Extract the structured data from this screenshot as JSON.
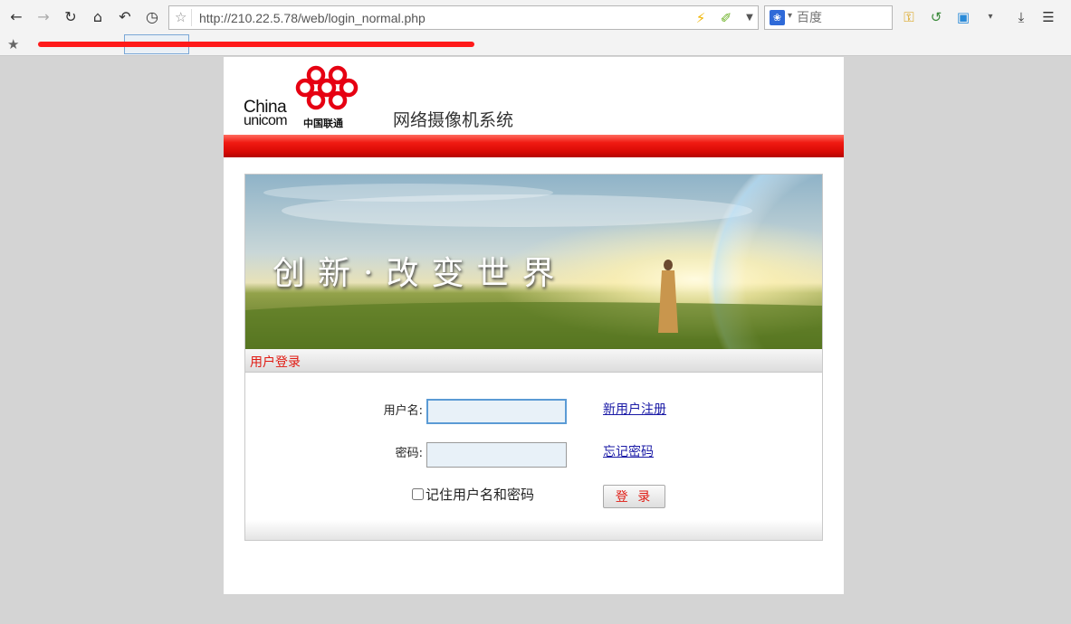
{
  "browser": {
    "url": "http://210.22.5.78/web/login_normal.php",
    "search_placeholder": "百度",
    "nav_icons": [
      "back-icon",
      "forward-icon",
      "reload-icon",
      "home-icon",
      "undo-icon",
      "history-icon"
    ],
    "toolbar_icons": [
      "lightning-icon",
      "pin-icon",
      "key-icon",
      "search-refresh-icon",
      "game-icon",
      "download-icon",
      "menu-icon"
    ]
  },
  "header": {
    "logo_en_line1": "China",
    "logo_en_line2": "unicom",
    "logo_cn": "中国联通",
    "system_title": "网络摄像机系统",
    "brand_red": "#e60012"
  },
  "banner": {
    "slogan": "创新·改变世界"
  },
  "login": {
    "section_title": "用户登录",
    "username_label": "用户名:",
    "username_value": "",
    "password_label": "密码:",
    "password_value": "",
    "register_link": "新用户注册",
    "forgot_link": "忘记密码",
    "remember_label": "记住用户名和密码",
    "remember_checked": false,
    "login_button": "登 录"
  }
}
